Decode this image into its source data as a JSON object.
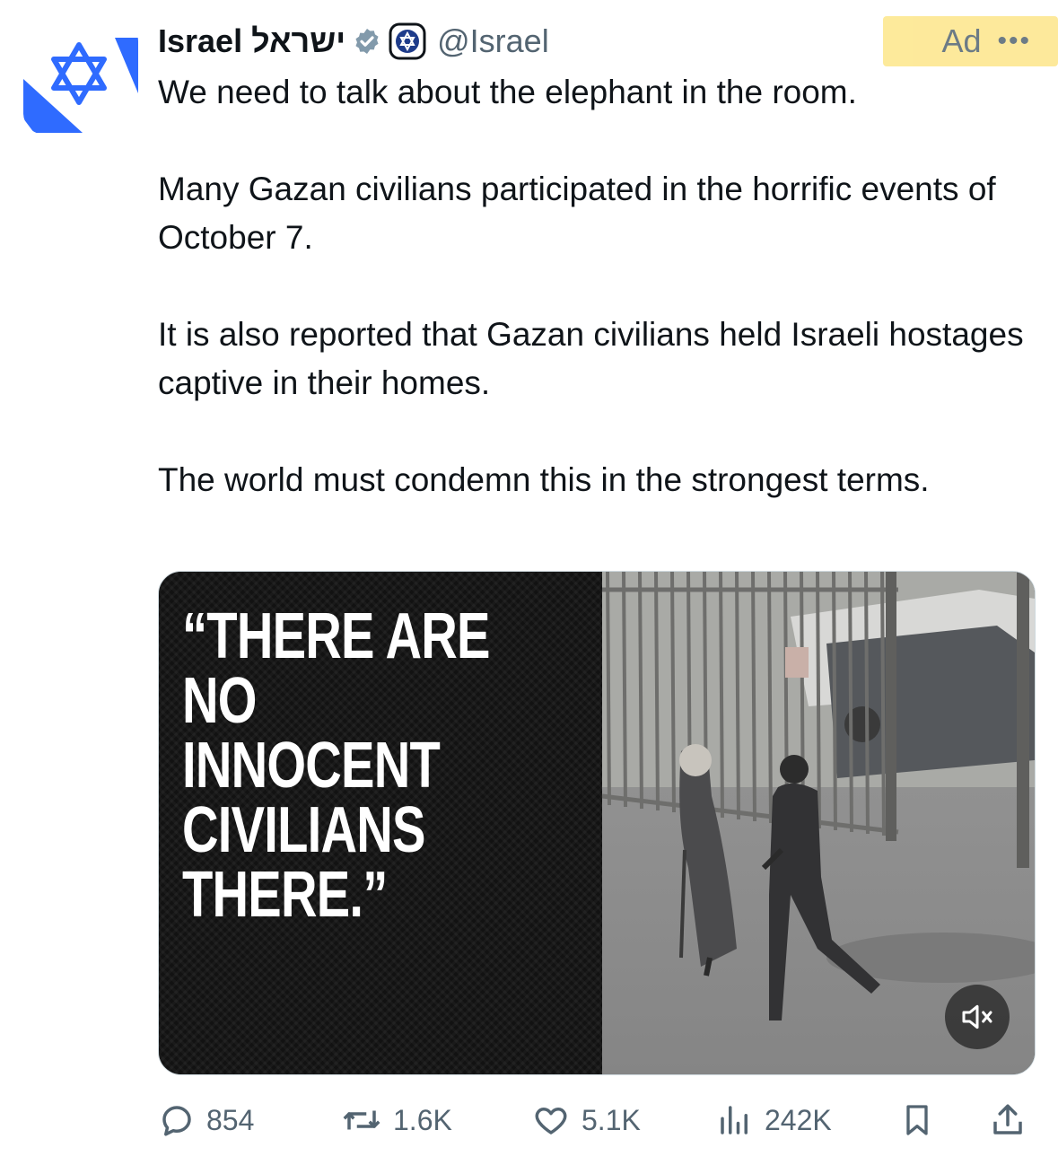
{
  "account": {
    "display_name": "Israel ישראל",
    "handle": "@Israel"
  },
  "ad_label": "Ad",
  "more_label": "•••",
  "tweet": {
    "paragraphs": [
      "We need to talk about the elephant in the room.",
      "Many Gazan civilians participated in the horrific events of October 7.",
      "It is also reported that Gazan civilians held Israeli hostages captive in their homes.",
      "The world must condemn this in the strongest terms."
    ]
  },
  "media": {
    "quote_lines": [
      "“THERE ARE NO",
      "INNOCENT",
      "CIVILIANS",
      "THERE.”"
    ]
  },
  "stats": {
    "replies": "854",
    "reposts": "1.6K",
    "likes": "5.1K",
    "views": "242K"
  },
  "icons": {
    "verified": "verified-badge-icon",
    "affiliation": "government-affiliation-icon",
    "reply": "reply-icon",
    "repost": "repost-icon",
    "like": "like-icon",
    "views": "views-icon",
    "bookmark": "bookmark-icon",
    "share": "share-icon",
    "mute": "muted-speaker-icon"
  },
  "colors": {
    "brand_blue": "#1d9bf0",
    "text": "#0f1419",
    "secondary": "#536471",
    "ad_highlight": "#fde68a",
    "flag_blue": "#2f6bff"
  }
}
